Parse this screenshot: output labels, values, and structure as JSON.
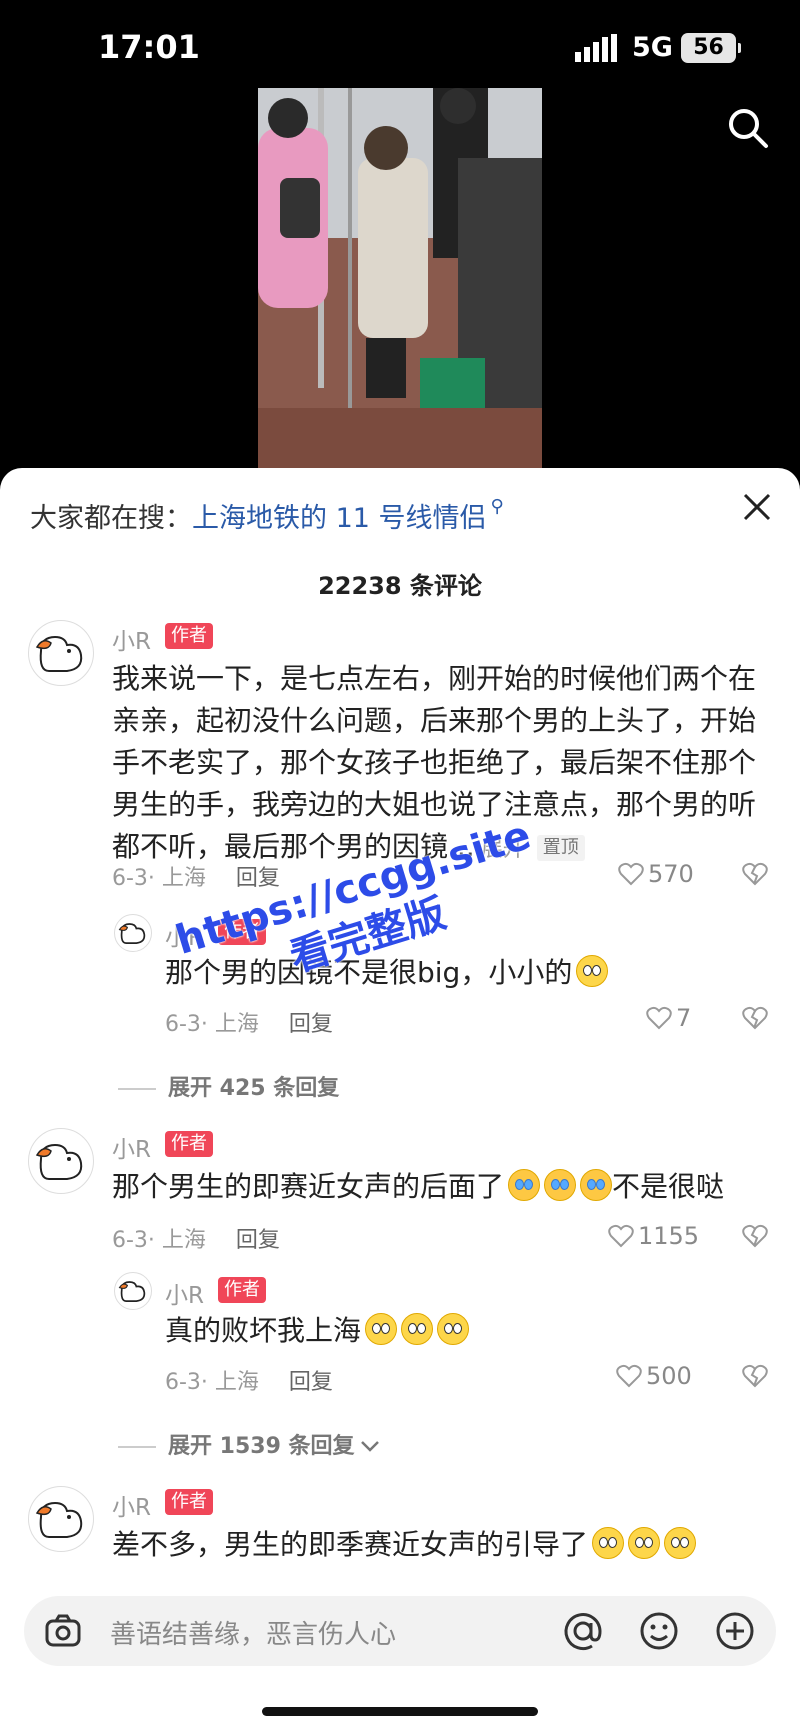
{
  "status": {
    "time": "17:01",
    "network": "5G",
    "battery": "56"
  },
  "sheet": {
    "hot_search_prefix": "大家都在搜：",
    "hot_search_topic": "上海地铁的 11 号线情侣",
    "comment_count": "22238 条评论"
  },
  "comments": [
    {
      "name": "小R",
      "tag": "作者",
      "text": "我来说一下，是七点左右，刚开始的时候他们两个在亲亲，起初没什么问题，后来那个男的上头了，开始手不老实了，那个女孩子也拒绝了，最后架不住那个男生的手，我旁边的大姐也说了注意点，那个男的听都不听，最后那个男的因镜...",
      "more": "展开",
      "pin": "置顶",
      "date": "6-3· 上海",
      "reply": "回复",
      "likes": "570",
      "replies": [
        {
          "name": "小R",
          "tag": "作者",
          "text": "那个男的因镜不是很big，小小的",
          "date": "6-3· 上海",
          "reply": "回复",
          "likes": "7"
        }
      ],
      "expand": "展开 425 条回复"
    },
    {
      "name": "小R",
      "tag": "作者",
      "text": "那个男生的即赛近女声的后面了",
      "text_suffix": "不是很哒",
      "date": "6-3· 上海",
      "reply": "回复",
      "likes": "1155",
      "replies": [
        {
          "name": "小R",
          "tag": "作者",
          "text": "真的败坏我上海",
          "date": "6-3· 上海",
          "reply": "回复",
          "likes": "500"
        }
      ],
      "expand": "展开 1539 条回复"
    },
    {
      "name": "小R",
      "tag": "作者",
      "text": "差不多，男生的即季赛近女声的引导了"
    }
  ],
  "input": {
    "placeholder": "善语结善缘，恶言伤人心"
  },
  "watermark": {
    "line1": "https://ccgg.site",
    "line2": "看完整版"
  },
  "icons": [
    "search-icon",
    "close-icon",
    "magnifier-icon",
    "heart-icon",
    "broken-heart-icon",
    "camera-icon",
    "at-icon",
    "emoji-icon",
    "plus-icon",
    "chevron-down-icon"
  ]
}
